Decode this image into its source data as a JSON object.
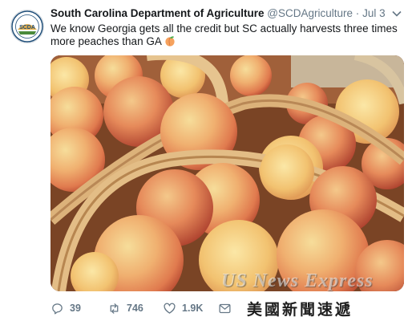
{
  "account": {
    "name": "South Carolina Department of Agriculture",
    "handle": "@SCDAgriculture",
    "separator": "·",
    "time": "Jul 3",
    "avatar_text": "SCDA"
  },
  "tweet": {
    "text": "We know Georgia gets all the credit but SC actually harvests three times more peaches than GA",
    "emoji": "peach"
  },
  "actions": {
    "replies": "39",
    "retweets": "746",
    "likes": "1.9K"
  },
  "watermark": {
    "en": "US News Express",
    "zh": "美國新聞速遞"
  },
  "icons": [
    "caret-down-icon",
    "reply-icon",
    "retweet-icon",
    "like-icon",
    "message-icon",
    "peach-emoji-icon"
  ],
  "colors": {
    "text": "#14171a",
    "secondary": "#657786",
    "peach": "#f0a060"
  }
}
